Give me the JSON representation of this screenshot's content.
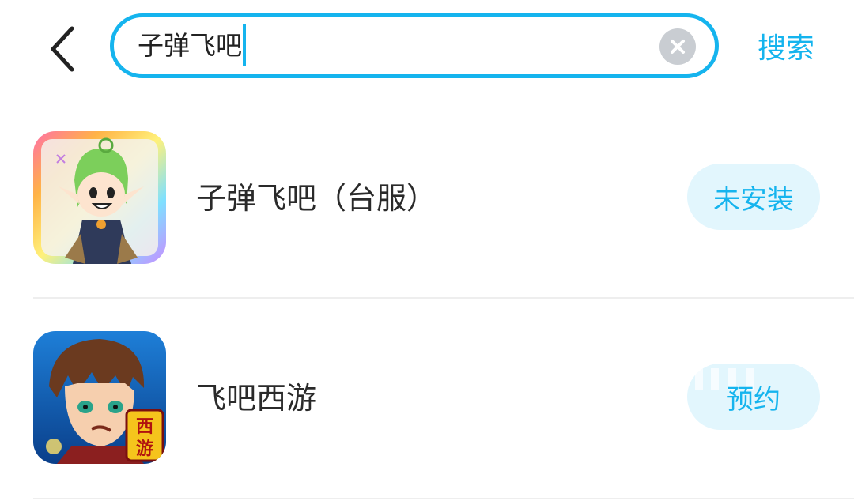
{
  "search": {
    "query": "子弹飞吧",
    "submit_label": "搜索"
  },
  "results": [
    {
      "name": "子弹飞吧（台服）",
      "action_label": "未安装"
    },
    {
      "name": "飞吧西游",
      "action_label": "预约",
      "icon_badge": "西游"
    }
  ],
  "colors": {
    "accent": "#15b4ee",
    "button_bg": "#e2f6fd",
    "clear_icon_bg": "#c9cdd2",
    "divider": "#eeeeee"
  }
}
